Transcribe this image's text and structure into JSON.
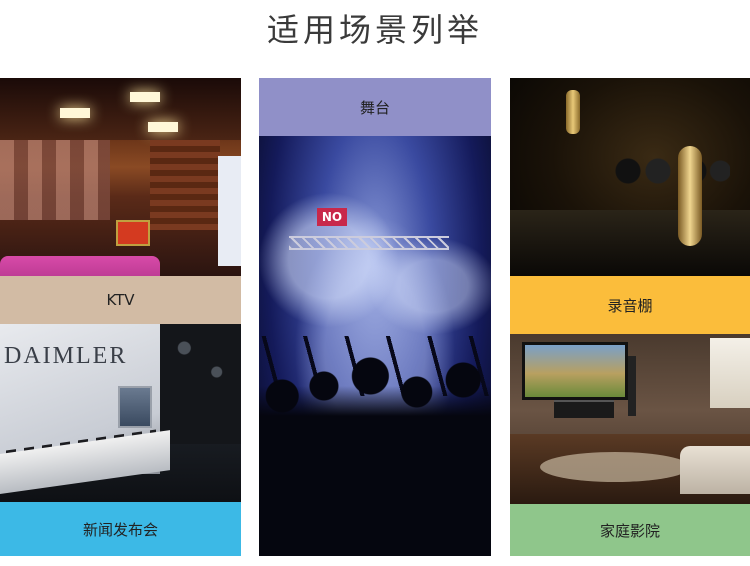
{
  "page": {
    "title": "适用场景列举"
  },
  "scenarios": [
    {
      "label": "KTV",
      "color": "#d2bba4"
    },
    {
      "label": "新闻发布会",
      "color": "#3cb9e6"
    },
    {
      "label": "舞台",
      "color": "#9090c8"
    },
    {
      "label": "录音棚",
      "color": "#fbbd3b"
    },
    {
      "label": "家庭影院",
      "color": "#8fc68b"
    }
  ],
  "photos": {
    "press_brand": "DAIMLER",
    "stage_sign": "NO"
  }
}
